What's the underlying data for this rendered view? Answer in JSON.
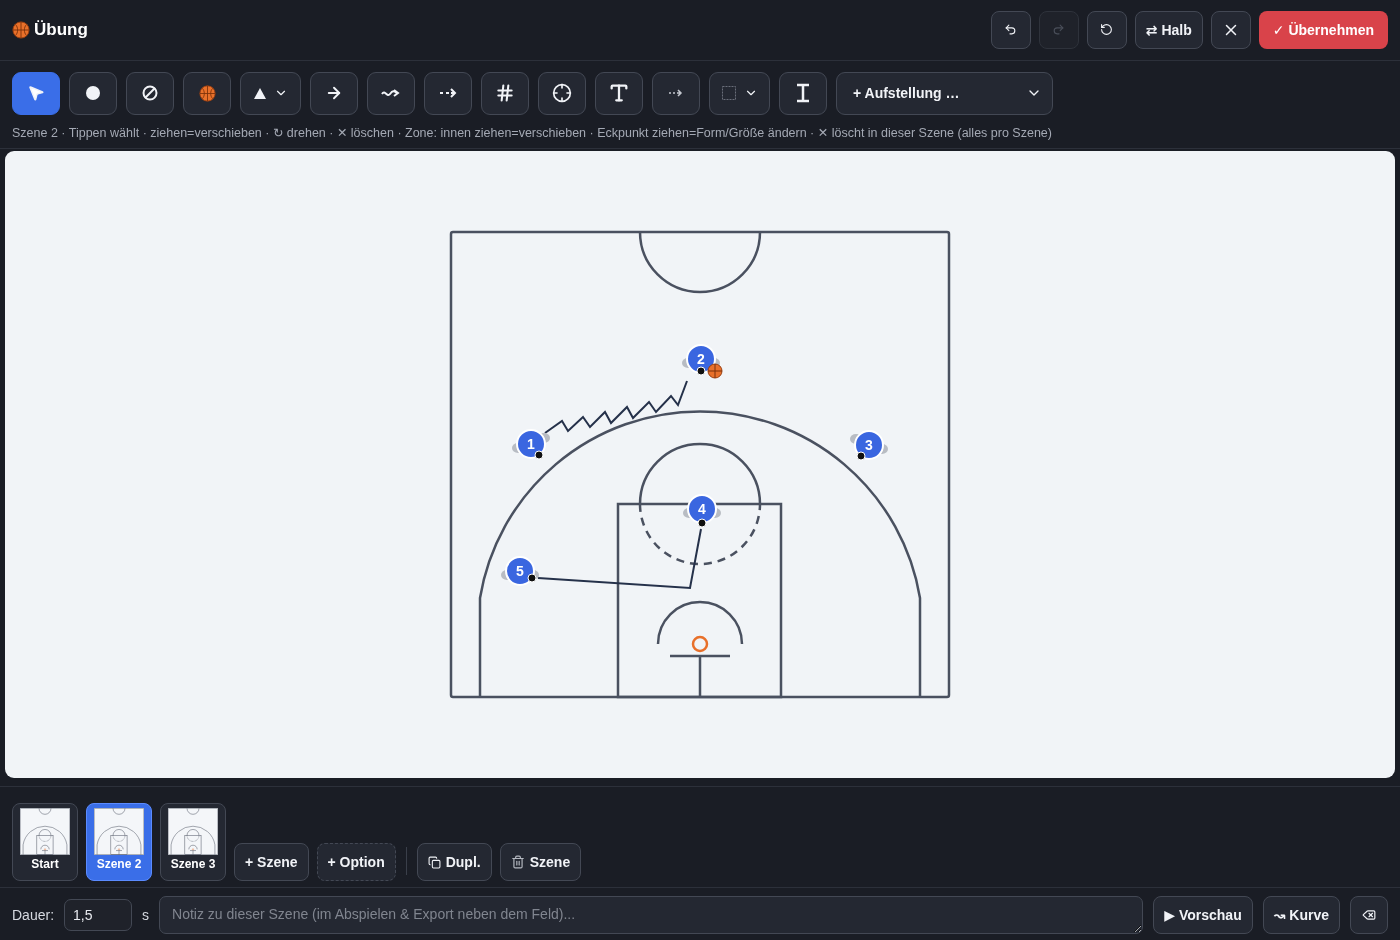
{
  "header": {
    "title": "Übung",
    "actions": [
      {
        "kind": "undo",
        "disabled": false
      },
      {
        "kind": "redo",
        "disabled": true
      },
      {
        "kind": "reset",
        "disabled": false
      }
    ],
    "half_button": "⇄ Halb",
    "apply_button": "✓ Übernehmen"
  },
  "tools": [
    {
      "kind": "select",
      "selected": true
    },
    {
      "kind": "player",
      "selected": false
    },
    {
      "kind": "defender",
      "selected": false
    },
    {
      "kind": "ball",
      "selected": false
    },
    {
      "kind": "cone",
      "selected": false,
      "dropdown": true
    },
    {
      "kind": "arrow",
      "selected": false
    },
    {
      "kind": "dribble",
      "selected": false
    },
    {
      "kind": "pass",
      "selected": false
    },
    {
      "kind": "screen",
      "selected": false
    },
    {
      "kind": "shot",
      "selected": false
    },
    {
      "kind": "block",
      "selected": false
    },
    {
      "kind": "dotted",
      "selected": false
    },
    {
      "kind": "zone",
      "selected": false,
      "dropdown": true
    },
    {
      "kind": "text",
      "selected": false
    }
  ],
  "formation_select": "+ Aufstellung …",
  "hint": "Szene 2 · Tippen wählt · ziehen=verschieben · ↻ drehen · ✕ löschen · Zone: innen ziehen=verschieben · Eckpunkt ziehen=Form/Größe ändern · ✕ löscht in dieser Szene (alles pro Szene)",
  "players": [
    {
      "number": "1",
      "has_ball": false
    },
    {
      "number": "2",
      "has_ball": true
    },
    {
      "number": "3",
      "has_ball": false
    },
    {
      "number": "4",
      "has_ball": false
    },
    {
      "number": "5",
      "has_ball": false
    }
  ],
  "scenes": [
    {
      "label": "Start",
      "selected": false
    },
    {
      "label": "Szene 2",
      "selected": true
    },
    {
      "label": "Szene 3",
      "selected": false
    }
  ],
  "scene_actions": [
    {
      "kind": "add",
      "label": "+ Szene"
    },
    {
      "kind": "option",
      "label": "+ Option"
    },
    {
      "kind": "duplicate",
      "label": "Dupl."
    },
    {
      "kind": "delete",
      "label": "Szene"
    }
  ],
  "duration": {
    "label": "Dauer:",
    "value": "1,5",
    "unit": "s"
  },
  "note": {
    "placeholder": "Notiz zu dieser Szene (im Abspielen & Export neben dem Feld)..."
  },
  "footer_buttons": [
    {
      "kind": "preview",
      "label": "▶ Vorschau"
    },
    {
      "kind": "curve",
      "label": "↝ Kurve"
    },
    {
      "kind": "clear"
    }
  ]
}
